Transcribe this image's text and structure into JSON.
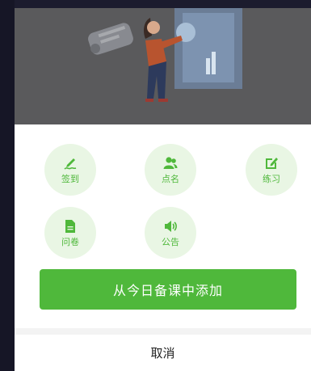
{
  "actions": [
    {
      "label": "签到",
      "icon": "pen-sign-icon"
    },
    {
      "label": "点名",
      "icon": "users-icon"
    },
    {
      "label": "练习",
      "icon": "edit-square-icon"
    },
    {
      "label": "问卷",
      "icon": "document-icon"
    },
    {
      "label": "公告",
      "icon": "speaker-icon"
    }
  ],
  "primary_button": {
    "label": "从今日备课中添加"
  },
  "cancel_button": {
    "label": "取消"
  },
  "colors": {
    "accent": "#4fb83b",
    "icon_bg": "#e9f6e4",
    "overlay": "#5a5a5c",
    "page_bg": "#1c1c2e"
  }
}
